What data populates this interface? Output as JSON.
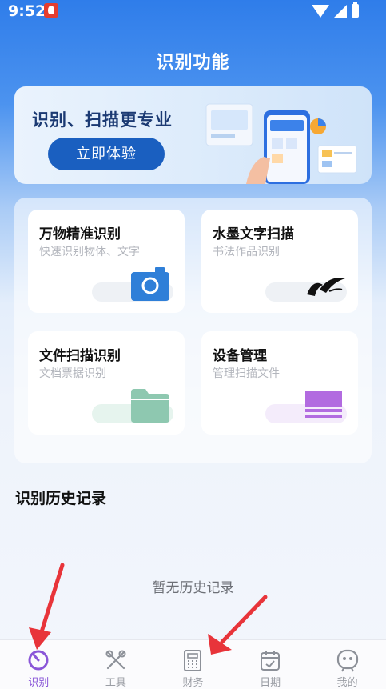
{
  "status_bar": {
    "time": "9:52"
  },
  "page_title": "识别功能",
  "banner": {
    "title": "识别、扫描更专业",
    "button_label": "立即体验"
  },
  "features": [
    {
      "title": "万物精准识别",
      "subtitle": "快速识别物体、文字",
      "icon": "camera-icon",
      "color": "#2f7fd8"
    },
    {
      "title": "水墨文字扫描",
      "subtitle": "书法作品识别",
      "icon": "ink-brush-icon",
      "color": "#111111"
    },
    {
      "title": "文件扫描识别",
      "subtitle": "文档票据识别",
      "icon": "folder-icon",
      "color": "#8ec8b0"
    },
    {
      "title": "设备管理",
      "subtitle": "管理扫描文件",
      "icon": "document-icon",
      "color": "#b26be0"
    }
  ],
  "history": {
    "title": "识别历史记录",
    "empty_text": "暂无历史记录"
  },
  "bottom_nav": {
    "items": [
      {
        "label": "识别",
        "icon": "scan-dial-icon",
        "active": true
      },
      {
        "label": "工具",
        "icon": "tools-icon",
        "active": false
      },
      {
        "label": "财务",
        "icon": "calculator-icon",
        "active": false
      },
      {
        "label": "日期",
        "icon": "calendar-icon",
        "active": false
      },
      {
        "label": "我的",
        "icon": "robot-face-icon",
        "active": false
      }
    ]
  },
  "colors": {
    "accent": "#8a56d8",
    "banner_button": "#1a5fc0",
    "annotation_arrow": "#e8343a"
  }
}
